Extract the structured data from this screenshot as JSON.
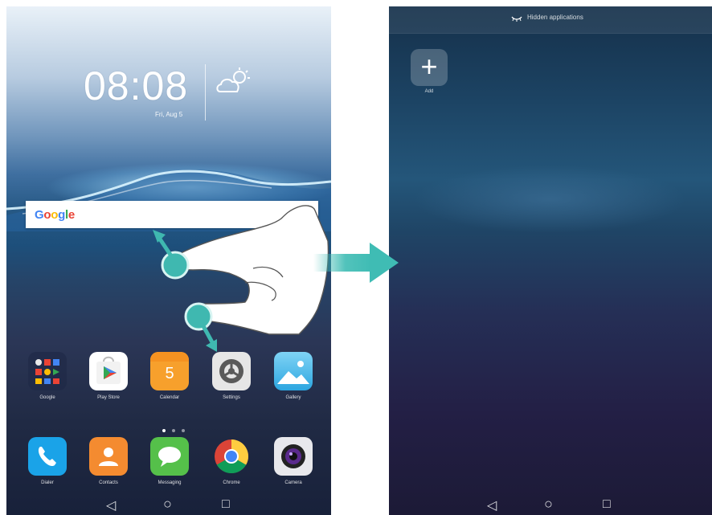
{
  "left_screen": {
    "clock": "08:08",
    "date": "Fri, Aug 5",
    "search": {
      "logo": "Google"
    },
    "apps_row1": [
      {
        "label": "Google",
        "icon": "google-folder-icon"
      },
      {
        "label": "Play Store",
        "icon": "play-store-icon"
      },
      {
        "label": "Calendar",
        "icon": "calendar-icon",
        "day": "5"
      },
      {
        "label": "Settings",
        "icon": "settings-icon"
      },
      {
        "label": "Gallery",
        "icon": "gallery-icon"
      }
    ],
    "dock": [
      {
        "label": "Dialer",
        "icon": "phone-icon"
      },
      {
        "label": "Contacts",
        "icon": "contacts-icon"
      },
      {
        "label": "Messaging",
        "icon": "messaging-icon"
      },
      {
        "label": "Chrome",
        "icon": "chrome-icon"
      },
      {
        "label": "Camera",
        "icon": "camera-icon"
      }
    ],
    "nav": {
      "back": "◁",
      "home": "○",
      "recents": "□"
    }
  },
  "right_screen": {
    "title": "Hidden applications",
    "add_label": "Add",
    "add_symbol": "+",
    "nav": {
      "back": "◁",
      "home": "○",
      "recents": "□"
    }
  },
  "colors": {
    "gesture_teal": "#3fb8b0",
    "arrow_teal": "#3fbcb4",
    "play_green": "#34a853",
    "calendar_orange": "#f7a02c",
    "phone_blue": "#1aa3e8",
    "contacts_orange": "#f48b30",
    "messaging_green": "#55c04a"
  }
}
